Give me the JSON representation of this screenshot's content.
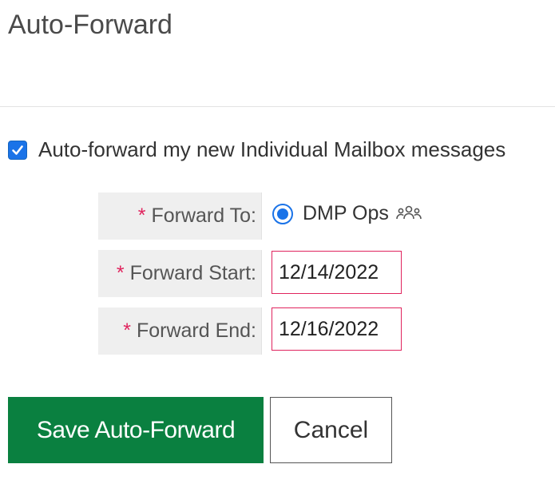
{
  "page": {
    "title": "Auto-Forward"
  },
  "enable": {
    "checked": true,
    "label": "Auto-forward my new Individual Mailbox messages"
  },
  "fields": {
    "forward_to": {
      "required_mark": "*",
      "label": "Forward To:",
      "option_label": "DMP Ops",
      "option_selected": true,
      "option_icon": "group-icon"
    },
    "forward_start": {
      "required_mark": "*",
      "label": "Forward Start:",
      "value": "12/14/2022"
    },
    "forward_end": {
      "required_mark": "*",
      "label": "Forward End:",
      "value": "12/16/2022"
    }
  },
  "buttons": {
    "save_label": "Save Auto-Forward",
    "cancel_label": "Cancel"
  },
  "colors": {
    "primary": "#0a8040",
    "required": "#e0245e",
    "accent": "#1a73e8"
  }
}
